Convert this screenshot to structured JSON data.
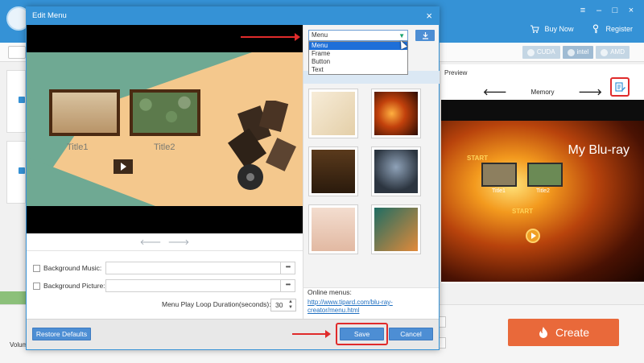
{
  "app": {
    "top_actions": [
      {
        "label": "Buy Now",
        "icon": "cart-icon"
      },
      {
        "label": "Register",
        "icon": "key-icon"
      }
    ],
    "hw_badges": [
      "CUDA",
      "intel",
      "AMD"
    ],
    "preview": {
      "label": "Preview",
      "nav_title": "Memory",
      "menu_title": "My Blu-ray",
      "start_a": "START",
      "start_b": "START",
      "title1": "Title1",
      "title2": "Title2"
    },
    "volume_label": "Volum",
    "create_label": "Create",
    "colors": {
      "accent": "#3592d6",
      "create": "#e9693a",
      "highlight": "#e02b2b"
    }
  },
  "dialog": {
    "title": "Edit Menu",
    "scene": {
      "title1": "Title1",
      "title2": "Title2"
    },
    "type_select": {
      "value": "Menu",
      "options": [
        "Menu",
        "Frame",
        "Button",
        "Text"
      ],
      "selected_index": 0
    },
    "background_music_label": "Background Music:",
    "background_picture_label": "Background Picture:",
    "more_label": "•••",
    "loop_label": "Menu Play Loop Duration(seconds):",
    "loop_value": "30",
    "online_label": "Online menus:",
    "online_link": "http://www.tipard.com/blu-ray-creator/menu.html",
    "restore_label": "Restore Defaults",
    "save_label": "Save",
    "cancel_label": "Cancel"
  }
}
